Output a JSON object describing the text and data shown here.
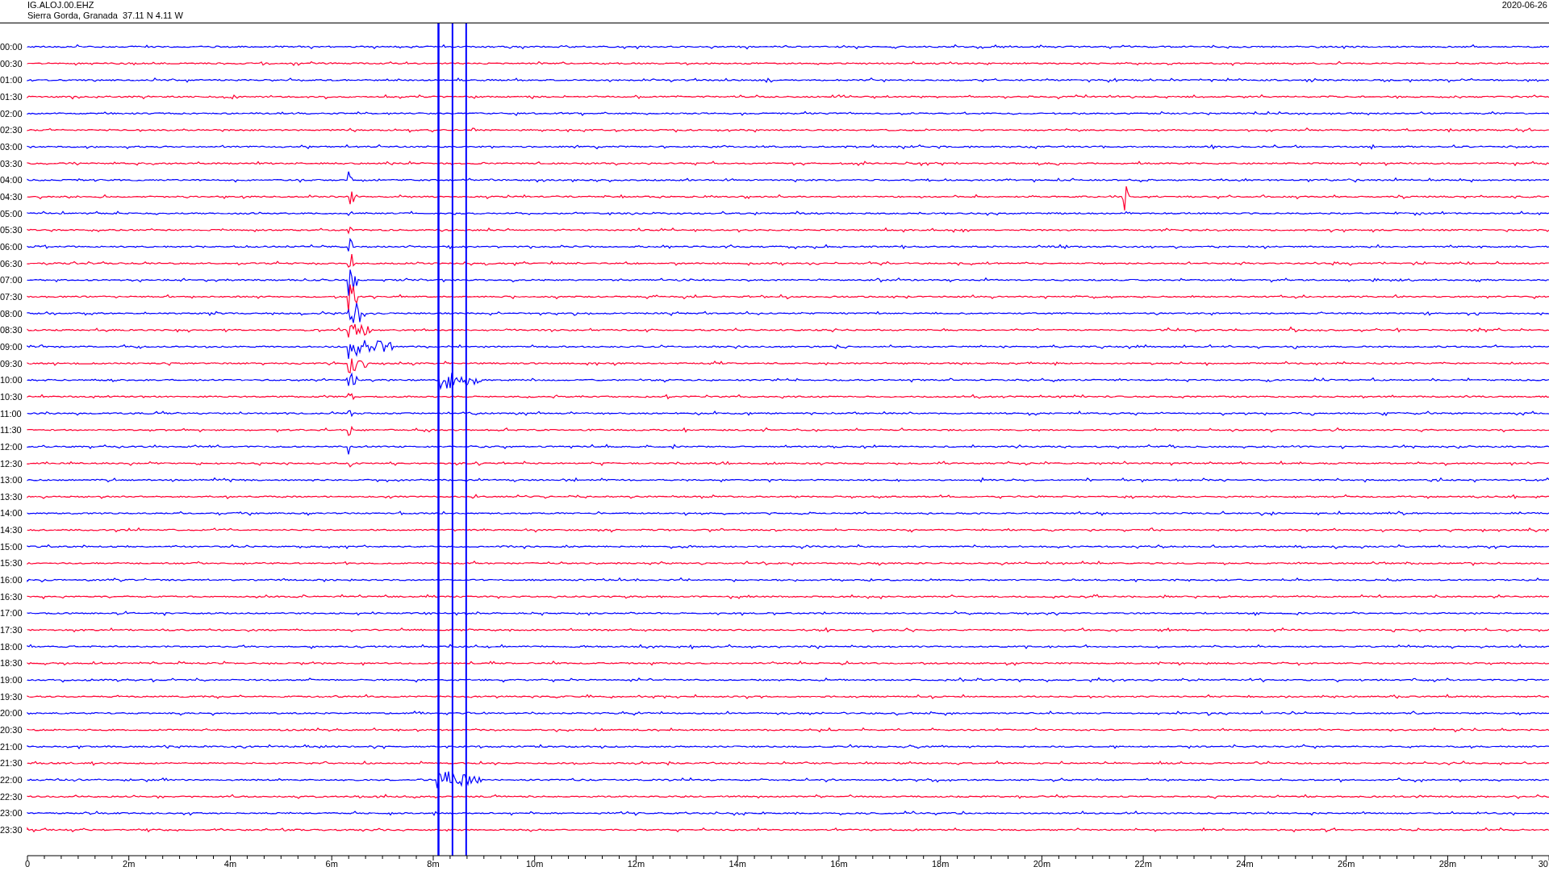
{
  "header": {
    "station": "IG.ALOJ.00.EHZ",
    "location": "Sierra Gorda, Granada  37.11 N 4.11 W",
    "date": "2020-06-26"
  },
  "rows": [
    {
      "time": "00:00",
      "color": "#0000ff"
    },
    {
      "time": "00:30",
      "color": "#ff0033"
    },
    {
      "time": "01:00",
      "color": "#0000ff"
    },
    {
      "time": "01:30",
      "color": "#ff0033"
    },
    {
      "time": "02:00",
      "color": "#0000ff"
    },
    {
      "time": "02:30",
      "color": "#ff0033"
    },
    {
      "time": "03:00",
      "color": "#0000ff"
    },
    {
      "time": "03:30",
      "color": "#ff0033"
    },
    {
      "time": "04:00",
      "color": "#0000ff"
    },
    {
      "time": "04:30",
      "color": "#ff0033"
    },
    {
      "time": "05:00",
      "color": "#0000ff"
    },
    {
      "time": "05:30",
      "color": "#ff0033"
    },
    {
      "time": "06:00",
      "color": "#0000ff"
    },
    {
      "time": "06:30",
      "color": "#ff0033"
    },
    {
      "time": "07:00",
      "color": "#0000ff"
    },
    {
      "time": "07:30",
      "color": "#ff0033"
    },
    {
      "time": "08:00",
      "color": "#0000ff"
    },
    {
      "time": "08:30",
      "color": "#ff0033"
    },
    {
      "time": "09:00",
      "color": "#0000ff"
    },
    {
      "time": "09:30",
      "color": "#ff0033"
    },
    {
      "time": "10:00",
      "color": "#0000ff"
    },
    {
      "time": "10:30",
      "color": "#ff0033"
    },
    {
      "time": "11:00",
      "color": "#0000ff"
    },
    {
      "time": "11:30",
      "color": "#ff0033"
    },
    {
      "time": "12:00",
      "color": "#0000ff"
    },
    {
      "time": "12:30",
      "color": "#ff0033"
    },
    {
      "time": "13:00",
      "color": "#0000ff"
    },
    {
      "time": "13:30",
      "color": "#ff0033"
    },
    {
      "time": "14:00",
      "color": "#0000ff"
    },
    {
      "time": "14:30",
      "color": "#ff0033"
    },
    {
      "time": "15:00",
      "color": "#0000ff"
    },
    {
      "time": "15:30",
      "color": "#ff0033"
    },
    {
      "time": "16:00",
      "color": "#0000ff"
    },
    {
      "time": "16:30",
      "color": "#ff0033"
    },
    {
      "time": "17:00",
      "color": "#0000ff"
    },
    {
      "time": "17:30",
      "color": "#ff0033"
    },
    {
      "time": "18:00",
      "color": "#0000ff"
    },
    {
      "time": "18:30",
      "color": "#ff0033"
    },
    {
      "time": "19:00",
      "color": "#0000ff"
    },
    {
      "time": "19:30",
      "color": "#ff0033"
    },
    {
      "time": "20:00",
      "color": "#0000ff"
    },
    {
      "time": "20:30",
      "color": "#ff0033"
    },
    {
      "time": "21:00",
      "color": "#0000ff"
    },
    {
      "time": "21:30",
      "color": "#ff0033"
    },
    {
      "time": "22:00",
      "color": "#0000ff"
    },
    {
      "time": "22:30",
      "color": "#ff0033"
    },
    {
      "time": "23:00",
      "color": "#0000ff"
    },
    {
      "time": "23:30",
      "color": "#ff0033"
    }
  ],
  "axis_labels": [
    "0",
    "2m",
    "4m",
    "6m",
    "8m",
    "10m",
    "12m",
    "14m",
    "16m",
    "18m",
    "20m",
    "22m",
    "24m",
    "26m",
    "28m",
    "30"
  ]
}
